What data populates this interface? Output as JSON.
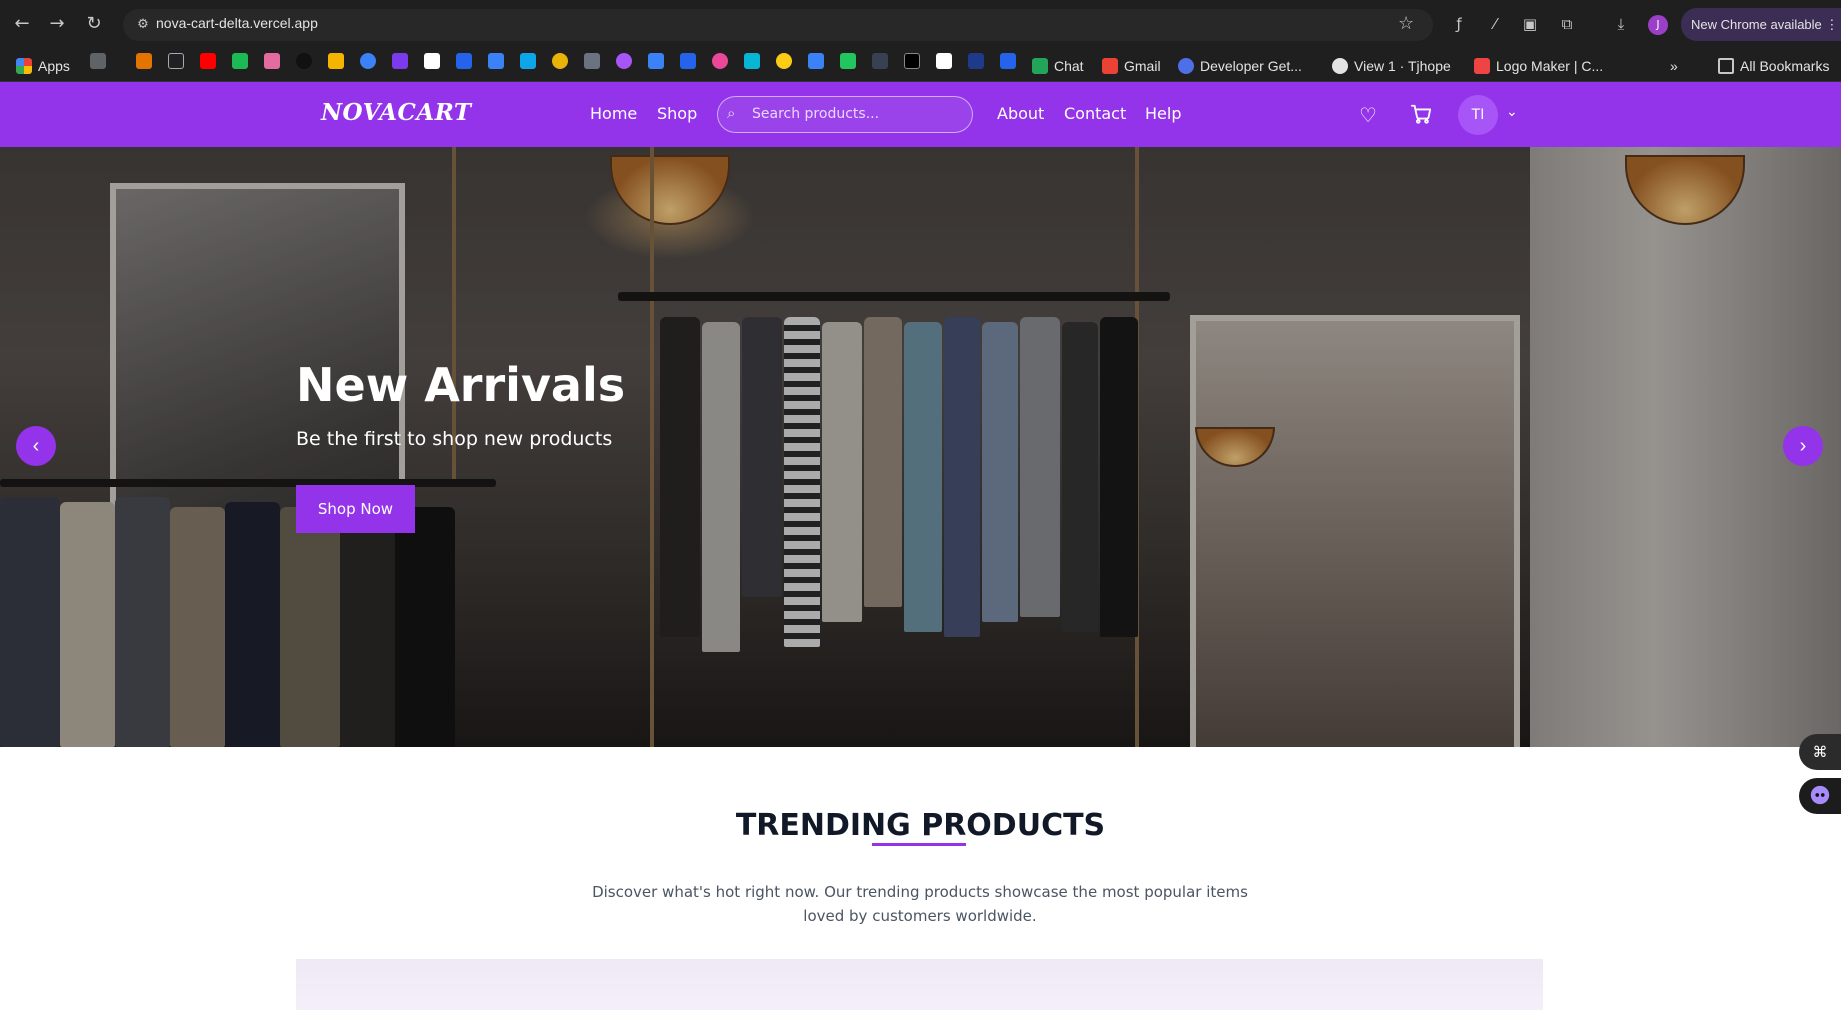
{
  "browser": {
    "url": "nova-cart-delta.vercel.app",
    "update_label": "New Chrome available",
    "profile_initial": "J",
    "bookmarks": {
      "apps": "Apps",
      "chat": "Chat",
      "gmail": "Gmail",
      "developer": "Developer Get...",
      "github": "View 1 · Tjhope",
      "logo_maker": "Logo Maker | C...",
      "more": "»",
      "all_bookmarks": "All Bookmarks"
    }
  },
  "site": {
    "logo": "NOVACART",
    "nav": {
      "home": "Home",
      "shop": "Shop",
      "about": "About",
      "contact": "Contact",
      "help": "Help"
    },
    "search_placeholder": "Search products...",
    "avatar_initials": "TI",
    "brand_color": "#9333ea"
  },
  "hero": {
    "title": "New Arrivals",
    "subtitle": "Be the first to shop new products",
    "cta": "Shop Now",
    "prev": "‹",
    "next": "›"
  },
  "trending": {
    "title": "TRENDING PRODUCTS",
    "description": "Discover what's hot right now. Our trending products showcase the most popular items loved by customers worldwide."
  },
  "icons": {
    "wishlist": "heart-icon",
    "cart": "cart-icon",
    "search": "search-icon",
    "chevron": "chevron-down-icon"
  }
}
